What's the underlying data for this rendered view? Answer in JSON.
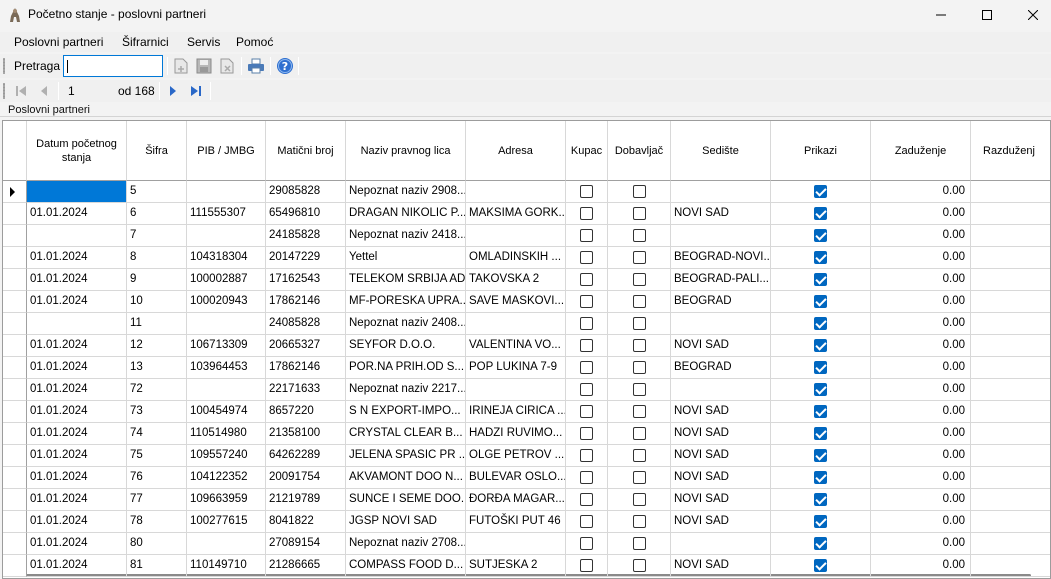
{
  "window": {
    "title": "Početno stanje - poslovni partneri"
  },
  "menu": [
    "Poslovni partneri",
    "Šifrarnici",
    "Servis",
    "Pomoć"
  ],
  "search": {
    "label": "Pretraga",
    "value": ""
  },
  "navigator": {
    "position": "1",
    "total_label": "od 168"
  },
  "panel": {
    "label": "Poslovni partneri"
  },
  "grid": {
    "columns": [
      "Datum početnog stanja",
      "Šifra",
      "PIB / JMBG",
      "Matični broj",
      "Naziv pravnog lica",
      "Adresa",
      "Kupac",
      "Dobavljač",
      "Sedište",
      "Prikazi",
      "Zaduženje",
      "Razduženj"
    ],
    "rows": [
      {
        "datum": "",
        "sifra": "5",
        "pib": "",
        "mb": "29085828",
        "naziv": "Nepoznat naziv 2908...",
        "adresa": "",
        "kupac": false,
        "dobavljac": false,
        "sediste": "",
        "prikazi": true,
        "zaduzenje": "0.00"
      },
      {
        "datum": "01.01.2024",
        "sifra": "6",
        "pib": "111555307",
        "mb": "65496810",
        "naziv": "DRAGAN NIKOLIC P...",
        "adresa": "MAKSIMA GORK...",
        "kupac": false,
        "dobavljac": false,
        "sediste": "NOVI SAD",
        "prikazi": true,
        "zaduzenje": "0.00"
      },
      {
        "datum": "",
        "sifra": "7",
        "pib": "",
        "mb": "24185828",
        "naziv": "Nepoznat naziv 2418...",
        "adresa": "",
        "kupac": false,
        "dobavljac": false,
        "sediste": "",
        "prikazi": true,
        "zaduzenje": "0.00"
      },
      {
        "datum": "01.01.2024",
        "sifra": "8",
        "pib": "104318304",
        "mb": "20147229",
        "naziv": "Yettel",
        "adresa": "OMLADINSKIH ...",
        "kupac": false,
        "dobavljac": false,
        "sediste": "BEOGRAD-NOVI...",
        "prikazi": true,
        "zaduzenje": "0.00"
      },
      {
        "datum": "01.01.2024",
        "sifra": "9",
        "pib": "100002887",
        "mb": "17162543",
        "naziv": "TELEKOM SRBIJA AD",
        "adresa": "TAKOVSKA 2",
        "kupac": false,
        "dobavljac": false,
        "sediste": "BEOGRAD-PALI...",
        "prikazi": true,
        "zaduzenje": "0.00"
      },
      {
        "datum": "01.01.2024",
        "sifra": "10",
        "pib": "100020943",
        "mb": "17862146",
        "naziv": "MF-PORESKA UPRA...",
        "adresa": "SAVE MASKOVI...",
        "kupac": false,
        "dobavljac": false,
        "sediste": "BEOGRAD",
        "prikazi": true,
        "zaduzenje": "0.00"
      },
      {
        "datum": "",
        "sifra": "11",
        "pib": "",
        "mb": "24085828",
        "naziv": "Nepoznat naziv 2408...",
        "adresa": "",
        "kupac": false,
        "dobavljac": false,
        "sediste": "",
        "prikazi": true,
        "zaduzenje": "0.00"
      },
      {
        "datum": "01.01.2024",
        "sifra": "12",
        "pib": "106713309",
        "mb": "20665327",
        "naziv": "SEYFOR D.O.O.",
        "adresa": "VALENTINA VO...",
        "kupac": false,
        "dobavljac": false,
        "sediste": "NOVI SAD",
        "prikazi": true,
        "zaduzenje": "0.00"
      },
      {
        "datum": "01.01.2024",
        "sifra": "13",
        "pib": "103964453",
        "mb": "17862146",
        "naziv": "POR.NA PRIH.OD S...",
        "adresa": "POP LUKINA 7-9",
        "kupac": false,
        "dobavljac": false,
        "sediste": "BEOGRAD",
        "prikazi": true,
        "zaduzenje": "0.00"
      },
      {
        "datum": "01.01.2024",
        "sifra": "72",
        "pib": "",
        "mb": "22171633",
        "naziv": "Nepoznat naziv 2217...",
        "adresa": "",
        "kupac": false,
        "dobavljac": false,
        "sediste": "",
        "prikazi": true,
        "zaduzenje": "0.00"
      },
      {
        "datum": "01.01.2024",
        "sifra": "73",
        "pib": "100454974",
        "mb": "8657220",
        "naziv": "S  N EXPORT-IMPO...",
        "adresa": "IRINEJA CIRICA ...",
        "kupac": false,
        "dobavljac": false,
        "sediste": "NOVI SAD",
        "prikazi": true,
        "zaduzenje": "0.00"
      },
      {
        "datum": "01.01.2024",
        "sifra": "74",
        "pib": "110514980",
        "mb": "21358100",
        "naziv": "CRYSTAL CLEAR B...",
        "adresa": "HADZI RUVIMO...",
        "kupac": false,
        "dobavljac": false,
        "sediste": "NOVI SAD",
        "prikazi": true,
        "zaduzenje": "0.00"
      },
      {
        "datum": "01.01.2024",
        "sifra": "75",
        "pib": "109557240",
        "mb": "64262289",
        "naziv": "JELENA SPASIC PR ...",
        "adresa": "OLGE PETROV ...",
        "kupac": false,
        "dobavljac": false,
        "sediste": "NOVI SAD",
        "prikazi": true,
        "zaduzenje": "0.00"
      },
      {
        "datum": "01.01.2024",
        "sifra": "76",
        "pib": "104122352",
        "mb": "20091754",
        "naziv": "AKVAMONT DOO N...",
        "adresa": "BULEVAR OSLO...",
        "kupac": false,
        "dobavljac": false,
        "sediste": "NOVI SAD",
        "prikazi": true,
        "zaduzenje": "0.00"
      },
      {
        "datum": "01.01.2024",
        "sifra": "77",
        "pib": "109663959",
        "mb": "21219789",
        "naziv": "SUNCE I SEME DOO...",
        "adresa": "ĐORĐA MAGAR...",
        "kupac": false,
        "dobavljac": false,
        "sediste": "NOVI SAD",
        "prikazi": true,
        "zaduzenje": "0.00"
      },
      {
        "datum": "01.01.2024",
        "sifra": "78",
        "pib": "100277615",
        "mb": "8041822",
        "naziv": "JGSP NOVI SAD",
        "adresa": "FUTOŠKI PUT 46",
        "kupac": false,
        "dobavljac": false,
        "sediste": "NOVI SAD",
        "prikazi": true,
        "zaduzenje": "0.00"
      },
      {
        "datum": "01.01.2024",
        "sifra": "80",
        "pib": "",
        "mb": "27089154",
        "naziv": "Nepoznat naziv 2708...",
        "adresa": "",
        "kupac": false,
        "dobavljac": false,
        "sediste": "",
        "prikazi": true,
        "zaduzenje": "0.00"
      },
      {
        "datum": "01.01.2024",
        "sifra": "81",
        "pib": "110149710",
        "mb": "21286665",
        "naziv": "COMPASS FOOD D...",
        "adresa": "SUTJESKA 2",
        "kupac": false,
        "dobavljac": false,
        "sediste": "NOVI SAD",
        "prikazi": true,
        "zaduzenje": "0.00"
      }
    ]
  }
}
